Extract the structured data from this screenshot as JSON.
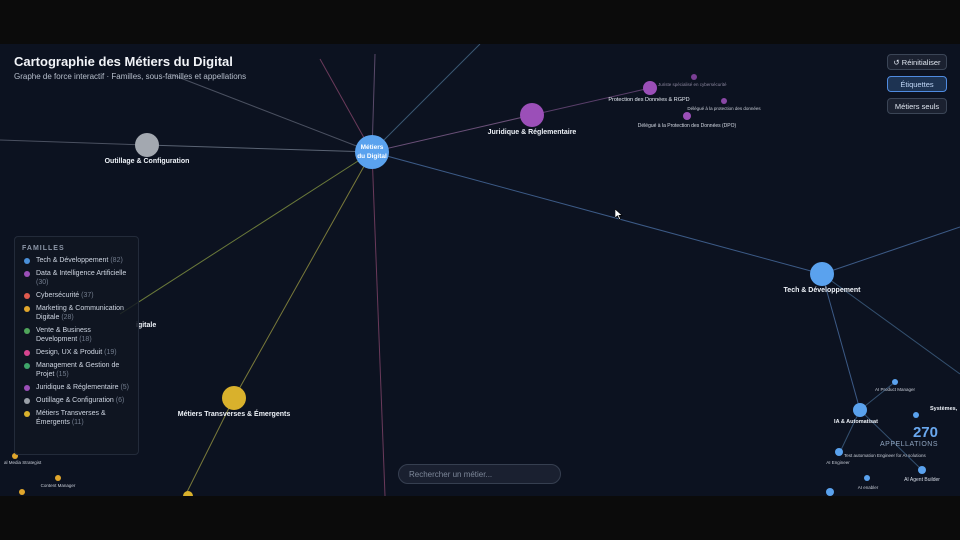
{
  "header": {
    "title": "Cartographie des Métiers du Digital",
    "subtitle": "Graphe de force interactif · Familles, sous-familles et appellations"
  },
  "controls": {
    "reset_label": "↺ Réinitialiser",
    "labels_label": "Étiquettes",
    "jobs_only_label": "Métiers seuls"
  },
  "search": {
    "placeholder": "Rechercher un métier..."
  },
  "counter": {
    "value": "270",
    "label": "APPELLATIONS"
  },
  "legend": {
    "title": "FAMILLES",
    "items": [
      {
        "label": "Tech & Développement",
        "count": "(82)",
        "color": "#4a90d9"
      },
      {
        "label": "Data & Intelligence Artificielle",
        "count": "(30)",
        "color": "#9b4fb8"
      },
      {
        "label": "Cybersécurité",
        "count": "(37)",
        "color": "#e05a4e"
      },
      {
        "label": "Marketing & Communication Digitale",
        "count": "(28)",
        "color": "#e0a62c"
      },
      {
        "label": "Vente & Business Development",
        "count": "(18)",
        "color": "#4fa55a"
      },
      {
        "label": "Design, UX & Produit",
        "count": "(19)",
        "color": "#d6448f"
      },
      {
        "label": "Management & Gestion de Projet",
        "count": "(15)",
        "color": "#3fa66a"
      },
      {
        "label": "Juridique & Réglementaire",
        "count": "(5)",
        "color": "#9b4fb8"
      },
      {
        "label": "Outillage & Configuration",
        "count": "(6)",
        "color": "#9aa0a8"
      },
      {
        "label": "Métiers Transverses & Émergents",
        "count": "(11)",
        "color": "#d9b12c"
      }
    ]
  },
  "graph": {
    "center": {
      "label_line1": "Métiers",
      "label_line2": "du Digital",
      "color": "#5aa2ee"
    },
    "families": [
      {
        "key": "outillage",
        "label": "Outillage & Configuration",
        "color": "#a3a8b0"
      },
      {
        "key": "juridique",
        "label": "Juridique & Réglementaire",
        "color": "#9b4fb8"
      },
      {
        "key": "tech",
        "label": "Tech & Développement",
        "color": "#5aa2ee"
      },
      {
        "key": "transverses",
        "label": "Métiers Transverses & Émergents",
        "color": "#d9b12c"
      }
    ],
    "partial_labels": {
      "marketing": "igitale",
      "systemes": "Systèmes,",
      "social": "al Media Strategist",
      "content": "Content Manager",
      "ia_auto": "IA & Automatisat",
      "ia_cyber": "Juriste spécialisé en cybersécurité"
    },
    "subfamilies": [
      {
        "label": "Protection des Données & RGPD",
        "color": "#9b4fb8"
      },
      {
        "label": "Délégué à la protection des données",
        "color": "#9b4fb8"
      },
      {
        "label": "Délégué à la Protection des Données (DPO)",
        "color": "#9b4fb8"
      }
    ],
    "jobs": [
      "AI Product Manager",
      "Test automation Engineer for AI solutions",
      "AI Engineer",
      "AI enabler",
      "AI Agent Builder"
    ]
  }
}
